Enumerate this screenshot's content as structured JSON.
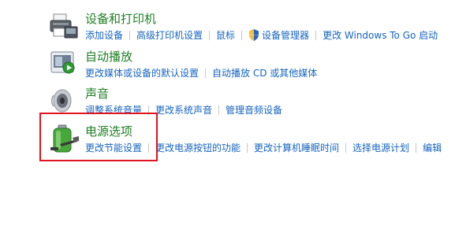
{
  "sections": [
    {
      "title": "设备和打印机",
      "icon": "printer-icon",
      "links": [
        "添加设备",
        "高级打印机设置",
        "鼠标",
        "设备管理器",
        "更改 Windows To Go 启动"
      ]
    },
    {
      "title": "自动播放",
      "icon": "autoplay-icon",
      "links": [
        "更改媒体或设备的默认设置",
        "自动播放 CD 或其他媒体"
      ]
    },
    {
      "title": "声音",
      "icon": "speaker-icon",
      "links": [
        "调整系统音量",
        "更改系统声音",
        "管理音频设备"
      ]
    },
    {
      "title": "电源选项",
      "icon": "battery-icon",
      "links": [
        "更改节能设置",
        "更改电源按钮的功能",
        "更改计算机睡眠时间",
        "选择电源计划",
        "编辑"
      ]
    }
  ],
  "colors": {
    "title": "#1e7f24",
    "link": "#1564c0",
    "highlight": "#e0141e",
    "separator": "#c8c8c8"
  }
}
